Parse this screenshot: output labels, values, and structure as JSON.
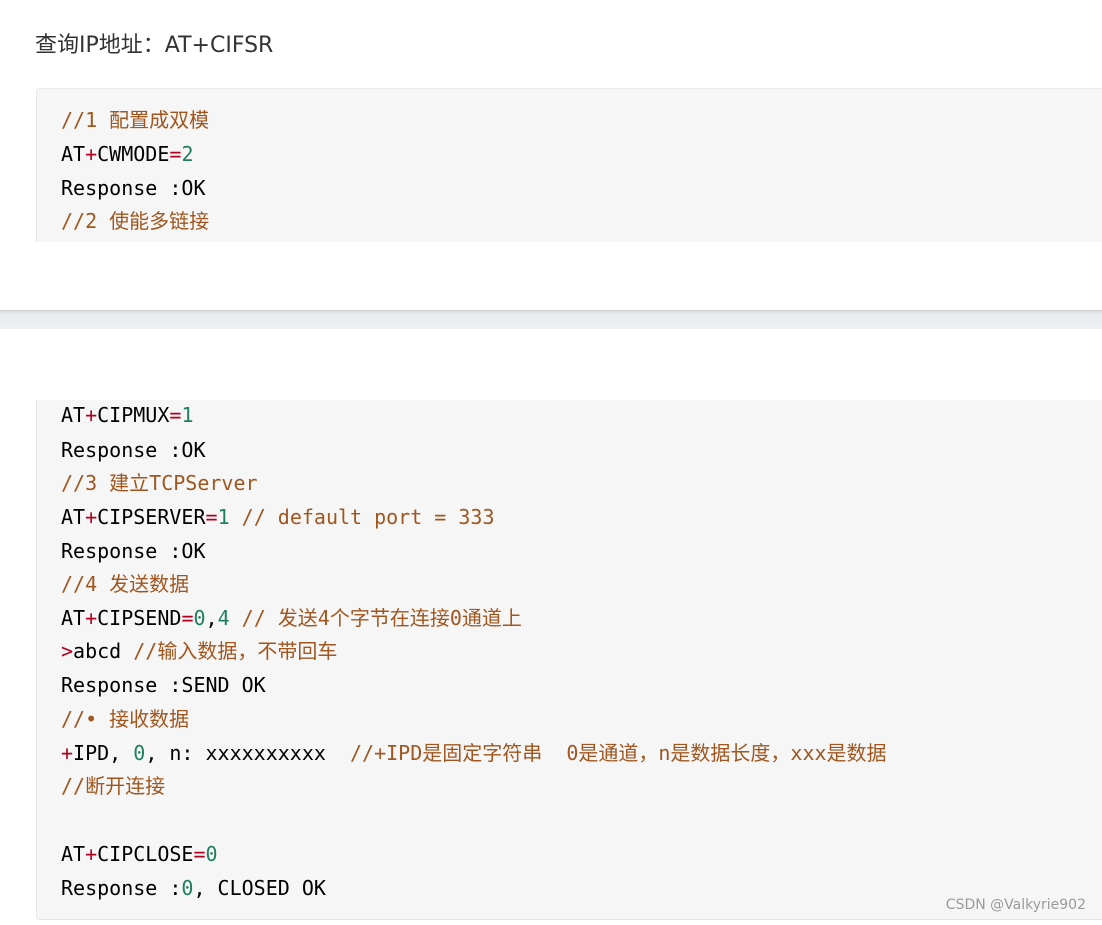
{
  "heading": "查询IP地址：AT+CIFSR",
  "block1": {
    "l1": "//1 配置成双模",
    "l2_a": "AT",
    "l2_op": "+",
    "l2_b": "CWMODE",
    "l2_eq": "=",
    "l2_v": "2",
    "l3": "Response :OK",
    "l4": "//2 使能多链接"
  },
  "block2": {
    "l1_a": "AT",
    "l1_op": "+",
    "l1_b": "CIPMUX",
    "l1_eq": "=",
    "l1_v": "1",
    "l2": "Response :OK",
    "l3": "//3 建立TCPServer",
    "l4_a": "AT",
    "l4_op": "+",
    "l4_b": "CIPSERVER",
    "l4_eq": "=",
    "l4_v": "1",
    "l4_c": " // default port = 333",
    "l5": "Response :OK",
    "l6": "//4 发送数据",
    "l7_a": "AT",
    "l7_op": "+",
    "l7_b": "CIPSEND",
    "l7_eq": "=",
    "l7_v1": "0",
    "l7_sep": ",",
    "l7_v2": "4",
    "l7_c": " // 发送4个字节在连接0通道上",
    "l8_op": ">",
    "l8_a": "abcd ",
    "l8_c": "//输入数据，不带回车",
    "l9": "Response :SEND OK",
    "l10": "//• 接收数据",
    "l11_op": "+",
    "l11_a": "IPD, ",
    "l11_v": "0",
    "l11_b": ", n: xxxxxxxxxx  ",
    "l11_c": "//+IPD是固定字符串  0是通道，n是数据长度，xxx是数据",
    "l12": "//断开连接",
    "l13_a": "AT",
    "l13_op": "+",
    "l13_b": "CIPCLOSE",
    "l13_eq": "=",
    "l13_v": "0",
    "l14_a": "Response :",
    "l14_v": "0",
    "l14_b": ", CLOSED OK"
  },
  "watermark": "CSDN @Valkyrie902",
  "colors": {
    "comment": "#a0561e",
    "number": "#1f7f5c",
    "operator": "#b00020",
    "code_bg": "#f6f6f6"
  }
}
